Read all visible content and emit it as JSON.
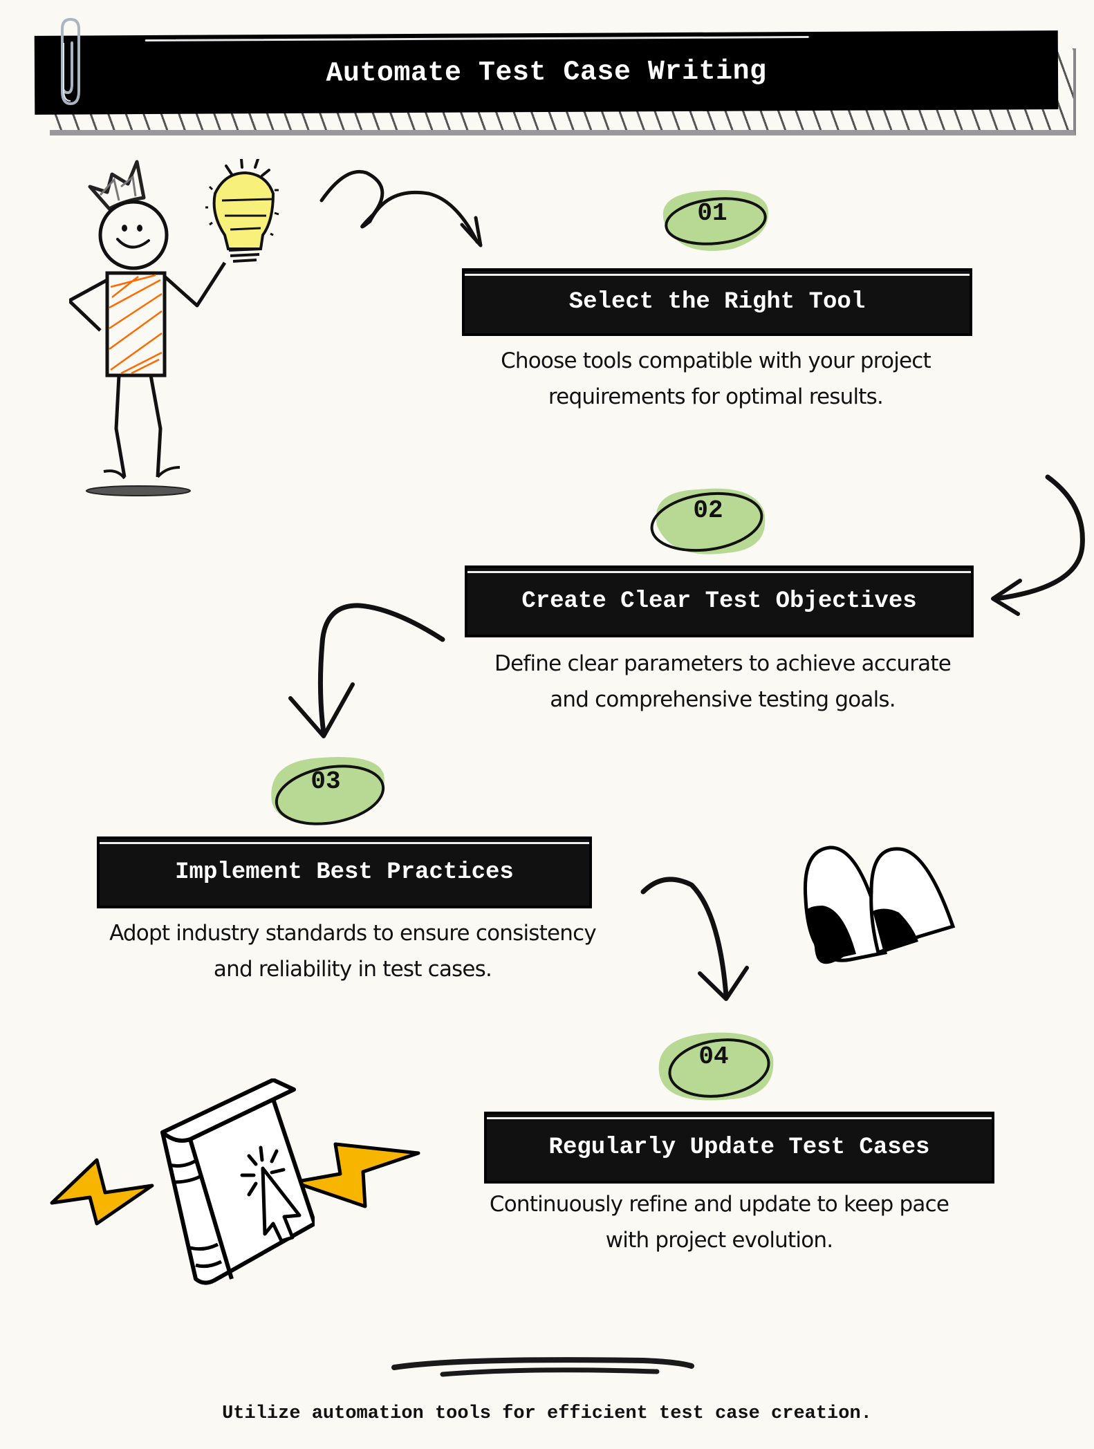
{
  "header": {
    "title": "Automate Test Case Writing"
  },
  "steps": [
    {
      "number": "01",
      "title": "Select the Right Tool",
      "description_lines": [
        "Choose tools compatible with your project",
        "requirements for optimal results."
      ]
    },
    {
      "number": "02",
      "title": "Create Clear Test Objectives",
      "description_lines": [
        "Define clear parameters to achieve accurate",
        "and comprehensive testing goals."
      ]
    },
    {
      "number": "03",
      "title": "Implement Best Practices",
      "description_lines": [
        "Adopt industry standards to ensure consistency",
        "and reliability in test cases."
      ]
    },
    {
      "number": "04",
      "title": "Regularly Update Test Cases",
      "description_lines": [
        "Continuously refine and update to keep pace",
        "with project evolution."
      ]
    }
  ],
  "footer": {
    "text": "Utilize automation tools for efficient test case creation."
  },
  "colors": {
    "background": "#faf9f4",
    "bar": "#111111",
    "badge_green": "#b8d993",
    "shirt_orange": "#ff6a00",
    "bulb_yellow": "#f7f07a",
    "bolt_yellow": "#f7b500"
  },
  "illustrations": {
    "person": "stick-figure-with-crown-icon",
    "bulb": "lightbulb-icon",
    "book": "book-with-cursor-icon",
    "bolts": "lightning-bolt-icon",
    "quote": "quote-marks-icon",
    "paperclip": "paperclip-icon"
  }
}
